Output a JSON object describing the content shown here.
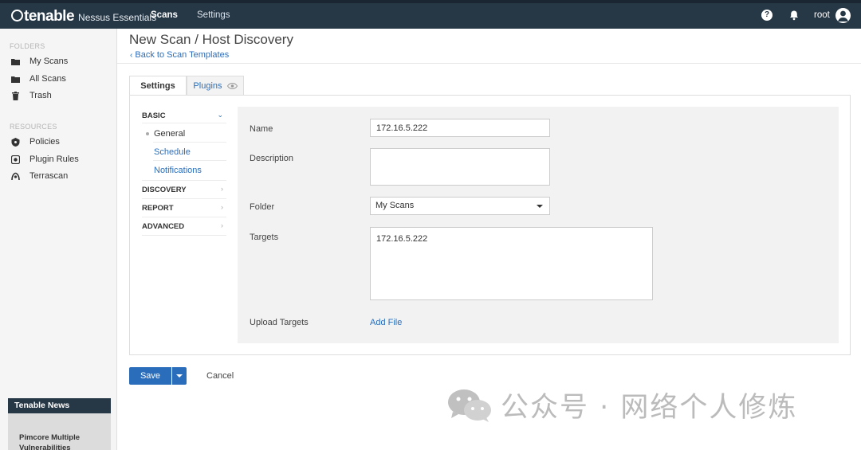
{
  "app": {
    "logo_text": "tenable",
    "product_name": "Nessus Essentials",
    "nav": [
      "Scans",
      "Settings"
    ],
    "user": "root",
    "help_icon": "question-circle-icon",
    "notification_icon": "bell-icon"
  },
  "sidebar": {
    "folders_heading": "FOLDERS",
    "folders": [
      {
        "label": "My Scans",
        "icon": "folder-icon"
      },
      {
        "label": "All Scans",
        "icon": "folder-icon"
      },
      {
        "label": "Trash",
        "icon": "trash-icon"
      }
    ],
    "resources_heading": "RESOURCES",
    "resources": [
      {
        "label": "Policies",
        "icon": "shield-icon"
      },
      {
        "label": "Plugin Rules",
        "icon": "plugin-icon"
      },
      {
        "label": "Terrascan",
        "icon": "terrascan-icon"
      }
    ],
    "news_heading": "Tenable News",
    "news_item": "Pimcore Multiple Vulnerabilities"
  },
  "page": {
    "title": "New Scan / Host Discovery",
    "back_link": "Back to Scan Templates"
  },
  "tabs": [
    {
      "label": "Settings",
      "active": true
    },
    {
      "label": "Plugins",
      "active": false
    }
  ],
  "left_nav": {
    "basic": "BASIC",
    "basic_items": [
      "General",
      "Schedule",
      "Notifications"
    ],
    "discovery": "DISCOVERY",
    "report": "REPORT",
    "advanced": "ADVANCED"
  },
  "form": {
    "name_label": "Name",
    "name_value": "172.16.5.222",
    "description_label": "Description",
    "description_value": "",
    "folder_label": "Folder",
    "folder_value": "My Scans",
    "targets_label": "Targets",
    "targets_value": "172.16.5.222",
    "upload_label": "Upload Targets",
    "add_file": "Add File"
  },
  "actions": {
    "save": "Save",
    "cancel": "Cancel"
  },
  "watermark": {
    "text": "公众号 · 网络个人修炼"
  },
  "colors": {
    "topbar": "#263746",
    "link": "#2a6ebb",
    "primary_button": "#2a6ebb"
  }
}
